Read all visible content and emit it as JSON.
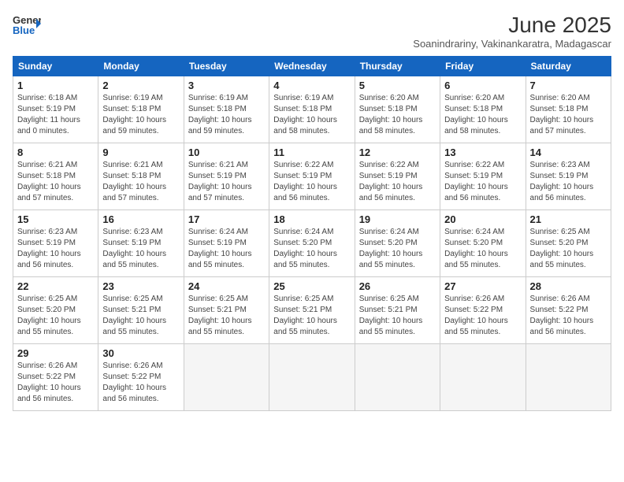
{
  "header": {
    "logo_line1": "General",
    "logo_line2": "Blue",
    "title": "June 2025",
    "subtitle": "Soanindrariny, Vakinankaratra, Madagascar"
  },
  "calendar": {
    "days_of_week": [
      "Sunday",
      "Monday",
      "Tuesday",
      "Wednesday",
      "Thursday",
      "Friday",
      "Saturday"
    ],
    "weeks": [
      [
        null,
        null,
        null,
        null,
        null,
        null,
        null
      ]
    ],
    "cells": [
      {
        "day": null
      },
      {
        "day": null
      },
      {
        "day": null
      },
      {
        "day": null
      },
      {
        "day": null
      },
      {
        "day": null
      },
      {
        "day": null
      }
    ]
  },
  "days": [
    {
      "num": "1",
      "sunrise": "6:18 AM",
      "sunset": "5:19 PM",
      "daylight": "11 hours and 0 minutes."
    },
    {
      "num": "2",
      "sunrise": "6:19 AM",
      "sunset": "5:18 PM",
      "daylight": "10 hours and 59 minutes."
    },
    {
      "num": "3",
      "sunrise": "6:19 AM",
      "sunset": "5:18 PM",
      "daylight": "10 hours and 59 minutes."
    },
    {
      "num": "4",
      "sunrise": "6:19 AM",
      "sunset": "5:18 PM",
      "daylight": "10 hours and 58 minutes."
    },
    {
      "num": "5",
      "sunrise": "6:20 AM",
      "sunset": "5:18 PM",
      "daylight": "10 hours and 58 minutes."
    },
    {
      "num": "6",
      "sunrise": "6:20 AM",
      "sunset": "5:18 PM",
      "daylight": "10 hours and 58 minutes."
    },
    {
      "num": "7",
      "sunrise": "6:20 AM",
      "sunset": "5:18 PM",
      "daylight": "10 hours and 57 minutes."
    },
    {
      "num": "8",
      "sunrise": "6:21 AM",
      "sunset": "5:18 PM",
      "daylight": "10 hours and 57 minutes."
    },
    {
      "num": "9",
      "sunrise": "6:21 AM",
      "sunset": "5:18 PM",
      "daylight": "10 hours and 57 minutes."
    },
    {
      "num": "10",
      "sunrise": "6:21 AM",
      "sunset": "5:19 PM",
      "daylight": "10 hours and 57 minutes."
    },
    {
      "num": "11",
      "sunrise": "6:22 AM",
      "sunset": "5:19 PM",
      "daylight": "10 hours and 56 minutes."
    },
    {
      "num": "12",
      "sunrise": "6:22 AM",
      "sunset": "5:19 PM",
      "daylight": "10 hours and 56 minutes."
    },
    {
      "num": "13",
      "sunrise": "6:22 AM",
      "sunset": "5:19 PM",
      "daylight": "10 hours and 56 minutes."
    },
    {
      "num": "14",
      "sunrise": "6:23 AM",
      "sunset": "5:19 PM",
      "daylight": "10 hours and 56 minutes."
    },
    {
      "num": "15",
      "sunrise": "6:23 AM",
      "sunset": "5:19 PM",
      "daylight": "10 hours and 56 minutes."
    },
    {
      "num": "16",
      "sunrise": "6:23 AM",
      "sunset": "5:19 PM",
      "daylight": "10 hours and 55 minutes."
    },
    {
      "num": "17",
      "sunrise": "6:24 AM",
      "sunset": "5:19 PM",
      "daylight": "10 hours and 55 minutes."
    },
    {
      "num": "18",
      "sunrise": "6:24 AM",
      "sunset": "5:20 PM",
      "daylight": "10 hours and 55 minutes."
    },
    {
      "num": "19",
      "sunrise": "6:24 AM",
      "sunset": "5:20 PM",
      "daylight": "10 hours and 55 minutes."
    },
    {
      "num": "20",
      "sunrise": "6:24 AM",
      "sunset": "5:20 PM",
      "daylight": "10 hours and 55 minutes."
    },
    {
      "num": "21",
      "sunrise": "6:25 AM",
      "sunset": "5:20 PM",
      "daylight": "10 hours and 55 minutes."
    },
    {
      "num": "22",
      "sunrise": "6:25 AM",
      "sunset": "5:20 PM",
      "daylight": "10 hours and 55 minutes."
    },
    {
      "num": "23",
      "sunrise": "6:25 AM",
      "sunset": "5:21 PM",
      "daylight": "10 hours and 55 minutes."
    },
    {
      "num": "24",
      "sunrise": "6:25 AM",
      "sunset": "5:21 PM",
      "daylight": "10 hours and 55 minutes."
    },
    {
      "num": "25",
      "sunrise": "6:25 AM",
      "sunset": "5:21 PM",
      "daylight": "10 hours and 55 minutes."
    },
    {
      "num": "26",
      "sunrise": "6:25 AM",
      "sunset": "5:21 PM",
      "daylight": "10 hours and 55 minutes."
    },
    {
      "num": "27",
      "sunrise": "6:26 AM",
      "sunset": "5:22 PM",
      "daylight": "10 hours and 55 minutes."
    },
    {
      "num": "28",
      "sunrise": "6:26 AM",
      "sunset": "5:22 PM",
      "daylight": "10 hours and 56 minutes."
    },
    {
      "num": "29",
      "sunrise": "6:26 AM",
      "sunset": "5:22 PM",
      "daylight": "10 hours and 56 minutes."
    },
    {
      "num": "30",
      "sunrise": "6:26 AM",
      "sunset": "5:22 PM",
      "daylight": "10 hours and 56 minutes."
    }
  ],
  "dow_headers": [
    "Sunday",
    "Monday",
    "Tuesday",
    "Wednesday",
    "Thursday",
    "Friday",
    "Saturday"
  ]
}
